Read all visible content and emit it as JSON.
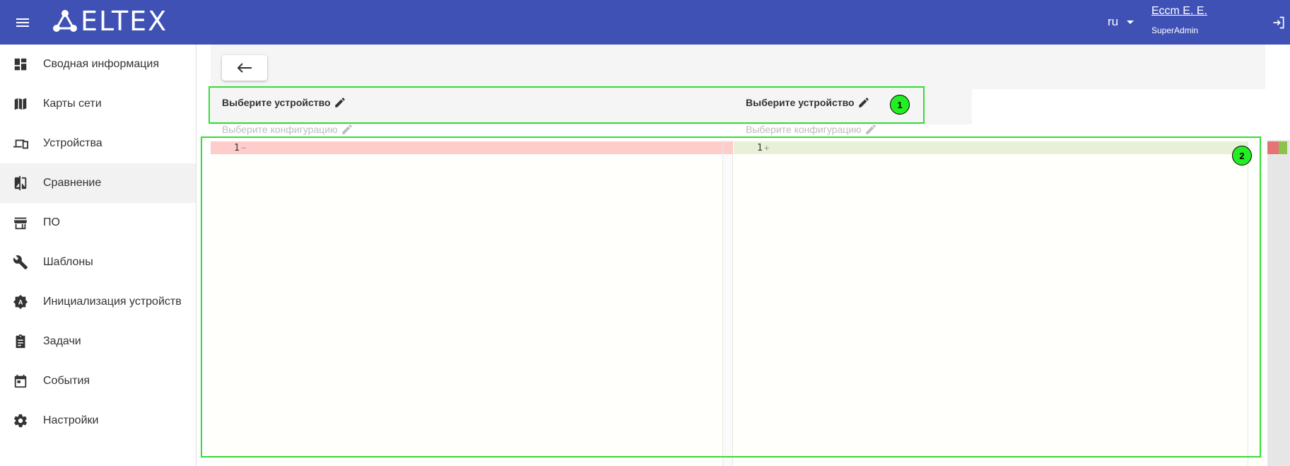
{
  "header": {
    "logo_text": "ELTEX",
    "language": "ru",
    "user_name": "Ессm Е. Е.",
    "user_role": "SuperAdmin",
    "bg_color": "#3f51b5"
  },
  "sidebar": {
    "items": [
      {
        "label": "Сводная информация",
        "icon": "dashboard-icon",
        "active": false
      },
      {
        "label": "Карты сети",
        "icon": "map-icon",
        "active": false
      },
      {
        "label": "Устройства",
        "icon": "devices-icon",
        "active": false
      },
      {
        "label": "Сравнение",
        "icon": "compare-icon",
        "active": true
      },
      {
        "label": "ПО",
        "icon": "store-icon",
        "active": false
      },
      {
        "label": "Шаблоны",
        "icon": "wrench-icon",
        "active": false
      },
      {
        "label": "Инициализация устройств",
        "icon": "auto-init-icon",
        "active": false
      },
      {
        "label": "Задачи",
        "icon": "clipboard-icon",
        "active": false
      },
      {
        "label": "События",
        "icon": "calendar-icon",
        "active": false
      },
      {
        "label": "Настройки",
        "icon": "gear-icon",
        "active": false
      }
    ]
  },
  "compare": {
    "left_device": "Выберите устройство",
    "right_device": "Выберите устройство",
    "left_config": "Выберите конфигурацию",
    "right_config": "Выберите конфигурацию",
    "left_line_number": "1",
    "right_line_number": "1",
    "left_marker": "−",
    "right_marker": "+"
  },
  "annotations": {
    "badge_1": "1",
    "badge_2": "2",
    "box_color": "#33dd33"
  }
}
